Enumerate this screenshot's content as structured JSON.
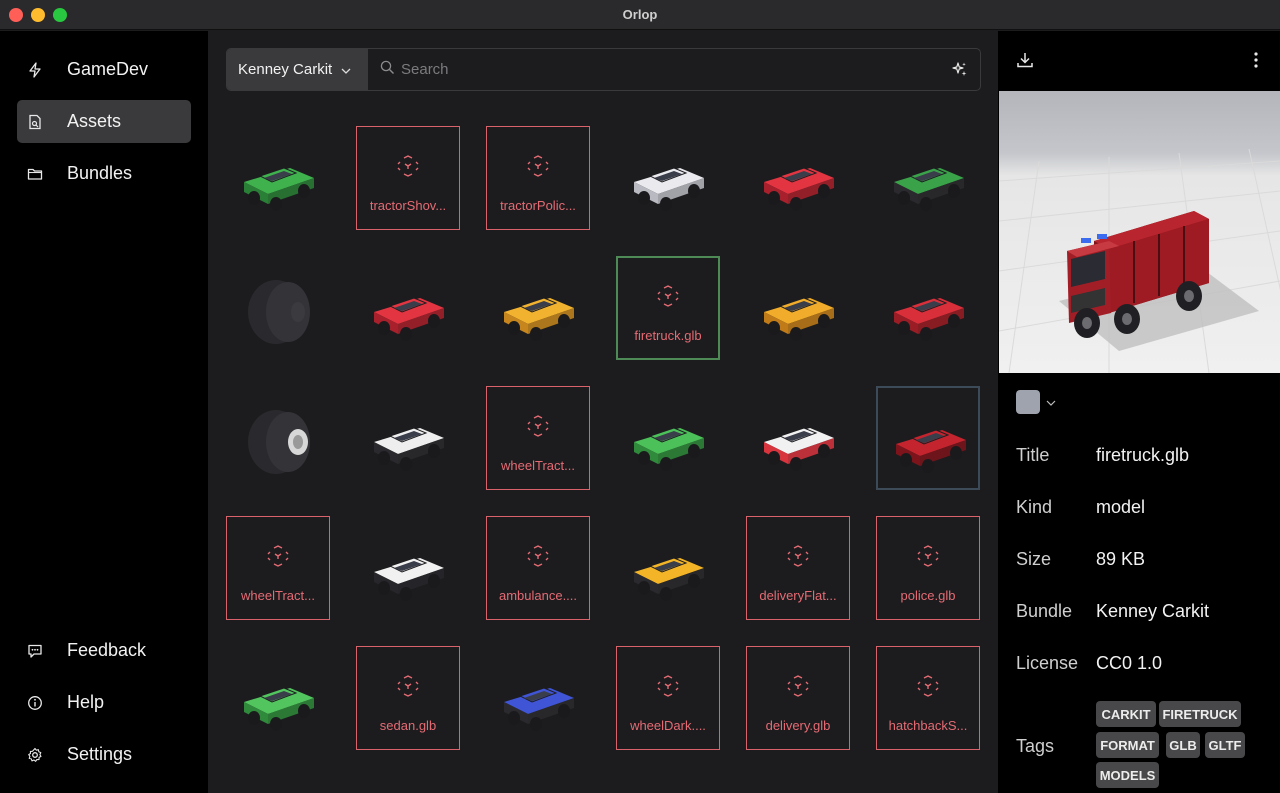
{
  "window": {
    "title": "Orlop"
  },
  "sidebar": {
    "top_items": [
      {
        "label": "GameDev",
        "icon": "bolt-icon"
      },
      {
        "label": "Assets",
        "icon": "asset-file-icon",
        "active": true
      },
      {
        "label": "Bundles",
        "icon": "folder-icon"
      }
    ],
    "bottom_items": [
      {
        "label": "Feedback",
        "icon": "chat-icon"
      },
      {
        "label": "Help",
        "icon": "info-icon"
      },
      {
        "label": "Settings",
        "icon": "gear-icon"
      }
    ]
  },
  "search": {
    "bundle": "Kenney Carkit",
    "placeholder": "Search",
    "value": ""
  },
  "grid": {
    "rows": [
      [
        {
          "kind": "image",
          "icon": "green-tractor-shovel"
        },
        {
          "kind": "placeholder",
          "name": "tractorShov..."
        },
        {
          "kind": "placeholder",
          "name": "tractorPolic..."
        },
        {
          "kind": "image",
          "icon": "white-pickup"
        },
        {
          "kind": "image",
          "icon": "red-sedan"
        },
        {
          "kind": "image",
          "icon": "green-suv"
        }
      ],
      [
        {
          "kind": "image",
          "icon": "dark-wheel"
        },
        {
          "kind": "image",
          "icon": "red-hatchback"
        },
        {
          "kind": "image",
          "icon": "yellow-taxi"
        },
        {
          "kind": "placeholder",
          "name": "firetruck.glb",
          "selected": "green"
        },
        {
          "kind": "image",
          "icon": "orange-suv"
        },
        {
          "kind": "image",
          "icon": "red-flatbed"
        }
      ],
      [
        {
          "kind": "image",
          "icon": "dark-wheel-hub"
        },
        {
          "kind": "image",
          "icon": "police-tractor"
        },
        {
          "kind": "placeholder",
          "name": "wheelTract..."
        },
        {
          "kind": "image",
          "icon": "green-sedan"
        },
        {
          "kind": "image",
          "icon": "ambulance"
        },
        {
          "kind": "image",
          "icon": "firetruck",
          "selected": "blue"
        }
      ],
      [
        {
          "kind": "placeholder",
          "name": "wheelTract..."
        },
        {
          "kind": "image",
          "icon": "police-car"
        },
        {
          "kind": "placeholder",
          "name": "ambulance...."
        },
        {
          "kind": "image",
          "icon": "yellow-tractor"
        },
        {
          "kind": "placeholder",
          "name": "deliveryFlat..."
        },
        {
          "kind": "placeholder",
          "name": "police.glb"
        }
      ],
      [
        {
          "kind": "image",
          "icon": "green-pickup"
        },
        {
          "kind": "placeholder",
          "name": "sedan.glb"
        },
        {
          "kind": "image",
          "icon": "blue-race-car"
        },
        {
          "kind": "placeholder",
          "name": "wheelDark...."
        },
        {
          "kind": "placeholder",
          "name": "delivery.glb"
        },
        {
          "kind": "placeholder",
          "name": "hatchbackS..."
        }
      ]
    ]
  },
  "details": {
    "color_swatch": "#9ea3ad",
    "fields": [
      {
        "key": "Title",
        "value": "firetruck.glb"
      },
      {
        "key": "Kind",
        "value": "model"
      },
      {
        "key": "Size",
        "value": "89 KB"
      },
      {
        "key": "Bundle",
        "value": "Kenney Carkit"
      },
      {
        "key": "License",
        "value": "CC0 1.0"
      }
    ],
    "tags_label": "Tags",
    "tags": [
      "CARKIT",
      "FIRETRUCK",
      "FORMAT",
      "GLB",
      "GLTF",
      "MODELS"
    ]
  },
  "colors": {
    "accent_error": "#e46b74",
    "selected_green": "#4d8a55",
    "sidebar_active": "#3a3a3c"
  }
}
